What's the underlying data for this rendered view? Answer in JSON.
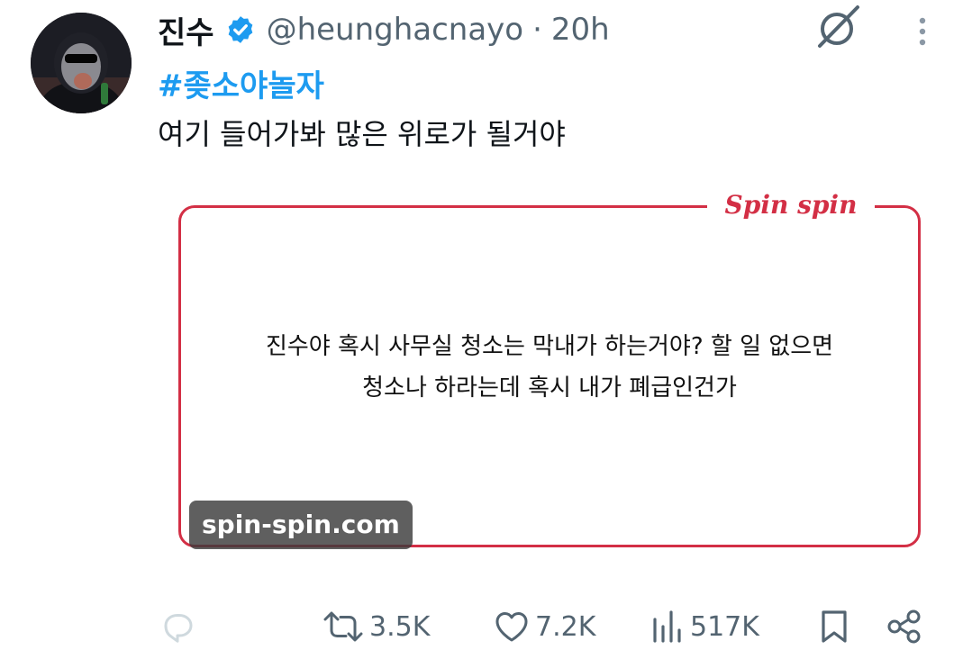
{
  "tweet": {
    "author_name": "진수",
    "handle": "@heunghacnayo",
    "separator": "·",
    "time": "20h",
    "hashtag": "#좆소야놀자",
    "text": "여기 들어가봐 많은 위로가 될거야"
  },
  "card": {
    "brand": "Spin spin",
    "lines": [
      "진수야 혹시 사무실 청소는 막내가 하는거야? 할 일 없으면",
      "청소나 하라는데 혹시 내가 폐급인건가"
    ],
    "domain": "spin-spin.com"
  },
  "actions": {
    "retweets": "3.5K",
    "likes": "7.2K",
    "views": "517K"
  },
  "colors": {
    "accent": "#1d9bf0",
    "muted": "#536471",
    "card_border": "#d32f45"
  },
  "icons": {
    "verified": "verified-badge-icon",
    "grok": "grok-icon",
    "more": "more-vertical-icon",
    "reply": "reply-icon",
    "retweet": "retweet-icon",
    "like": "heart-icon",
    "views": "views-chart-icon",
    "bookmark": "bookmark-icon",
    "share": "share-icon"
  }
}
